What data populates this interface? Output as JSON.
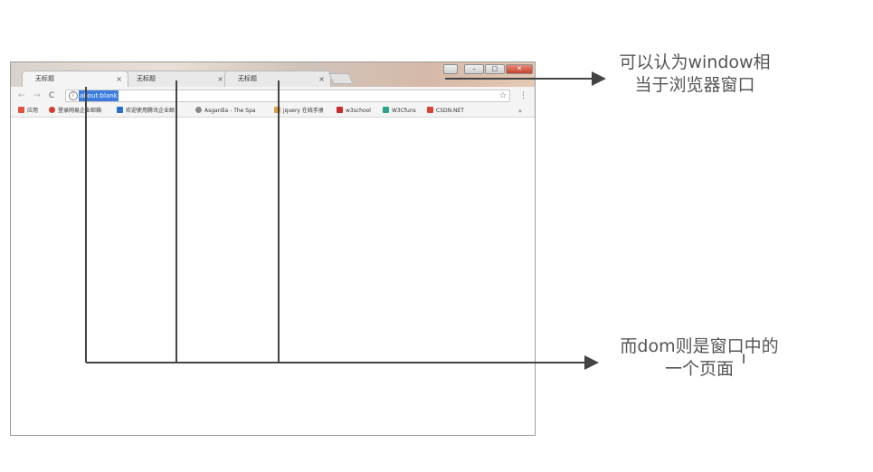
{
  "browser": {
    "tabs": [
      {
        "label": "无标题",
        "active": true,
        "close": "×"
      },
      {
        "label": "无标题",
        "active": false,
        "close": "×"
      },
      {
        "label": "无标题",
        "active": false,
        "close": "×"
      }
    ],
    "window_buttons": {
      "minimize": "–",
      "maximize": "□",
      "close": "✕"
    },
    "nav": {
      "back": "←",
      "forward": "→",
      "reload": "C"
    },
    "address": {
      "info": "i",
      "url": "about:blank",
      "star": "☆",
      "menu": "⋮"
    },
    "bookmarks": [
      {
        "label": "应用",
        "icon": "apps-grid-icon",
        "color": "#e0543f"
      },
      {
        "label": "登录网易企业邮箱",
        "icon": "netease-mail-icon",
        "color": "#d23a2f"
      },
      {
        "label": "欢迎使用腾讯企业邮",
        "icon": "tencent-mail-icon",
        "color": "#2b6fc9"
      },
      {
        "label": "Asgardia - The Spa",
        "icon": "asgardia-icon",
        "color": "#8a8a8a"
      },
      {
        "label": "jquery 在线手册",
        "icon": "jquery-icon",
        "color": "#d9a24a"
      },
      {
        "label": "w3school",
        "icon": "w3school-icon",
        "color": "#c72d2d"
      },
      {
        "label": "W3Cfuns",
        "icon": "w3cfuns-icon",
        "color": "#27a58a"
      },
      {
        "label": "CSDN.NET",
        "icon": "csdn-icon",
        "color": "#d6432e"
      }
    ],
    "more": "»"
  },
  "annotations": {
    "window_note": [
      "可以认为window相",
      "当于浏览器窗口"
    ],
    "dom_note": [
      "而dom则是窗口中的",
      "一个页面"
    ]
  },
  "colors": {
    "arrow": "#444444",
    "annotation_text": "#555555",
    "url_highlight": "#3b7ce0"
  }
}
